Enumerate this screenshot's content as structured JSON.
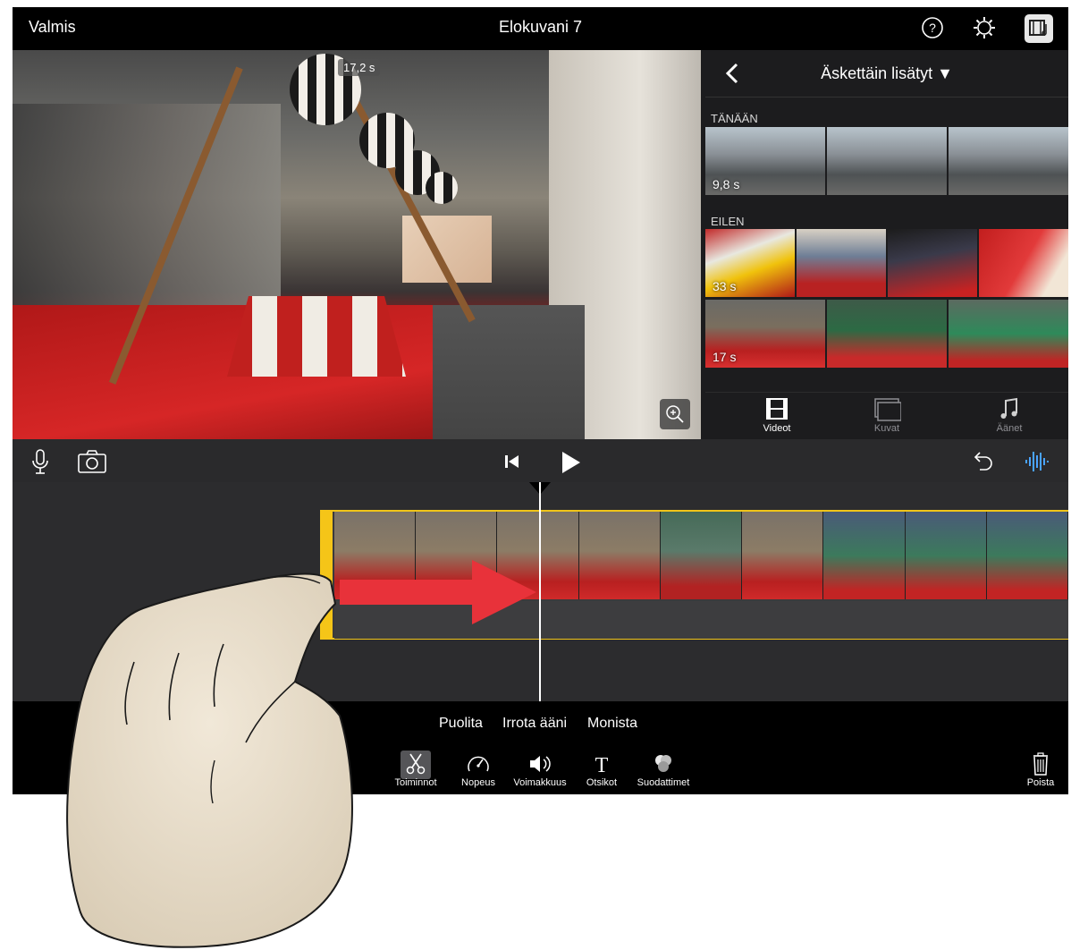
{
  "topbar": {
    "done_label": "Valmis",
    "title": "Elokuvani 7",
    "icons": [
      "help-icon",
      "settings-icon",
      "project-settings-icon"
    ]
  },
  "viewer": {
    "clip_duration": "17,2 s",
    "zoom_icon": "zoom-in-icon"
  },
  "browser": {
    "title": "Äskettäin lisätyt ▼",
    "sections": [
      {
        "label": "TÄNÄÄN",
        "clips": [
          {
            "duration": "9,8 s"
          }
        ]
      },
      {
        "label": "EILEN",
        "clips": [
          {
            "duration": "33 s"
          },
          {
            "duration": "17 s"
          }
        ]
      }
    ],
    "tabs": [
      {
        "label": "Videot",
        "icon": "film-icon"
      },
      {
        "label": "Kuvat",
        "icon": "photos-icon"
      },
      {
        "label": "Äänet",
        "icon": "music-icon"
      }
    ]
  },
  "controls": {
    "icons": [
      "microphone-icon",
      "camera-icon",
      "skip-to-start-icon",
      "play-icon",
      "undo-icon",
      "audio-waveform-icon"
    ]
  },
  "actions": {
    "split": "Puolita",
    "detach_audio": "Irrota ääni",
    "duplicate": "Monista"
  },
  "tools": [
    {
      "label": "Toiminnot",
      "icon": "scissors-icon"
    },
    {
      "label": "Nopeus",
      "icon": "speedometer-icon"
    },
    {
      "label": "Voimakkuus",
      "icon": "speaker-icon"
    },
    {
      "label": "Otsikot",
      "icon": "title-text-icon"
    },
    {
      "label": "Suodattimet",
      "icon": "filters-icon"
    }
  ],
  "delete": {
    "label": "Poista",
    "icon": "trash-icon"
  },
  "colors": {
    "accent": "#f5c518",
    "waveform": "#4aa3ff",
    "arrow": "#e8323a"
  }
}
